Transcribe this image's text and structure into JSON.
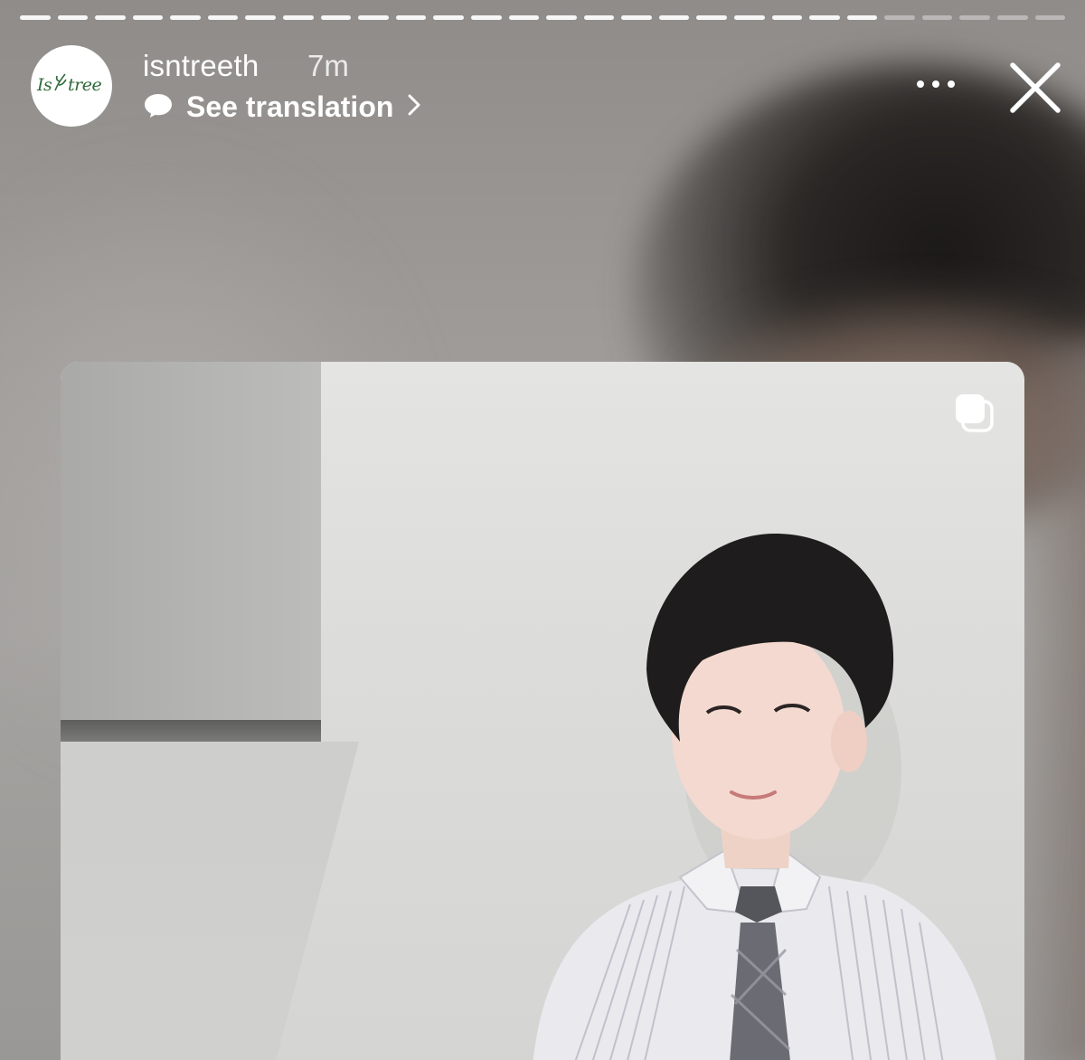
{
  "story": {
    "progress": {
      "segments_total": 28,
      "segments_done": 23
    }
  },
  "header": {
    "avatar_logo_text": "IsNtree",
    "username": "isntreeth",
    "time": "7m",
    "translation_label": "See translation"
  },
  "icons": {
    "translation": "speech-bubble-icon",
    "chevron": "chevron-right-icon",
    "more": "more-dots-icon",
    "close": "close-icon",
    "multi_photo": "carousel-stack-icon"
  },
  "colors": {
    "text": "#ffffff",
    "logo_green": "#2f6a3a"
  }
}
